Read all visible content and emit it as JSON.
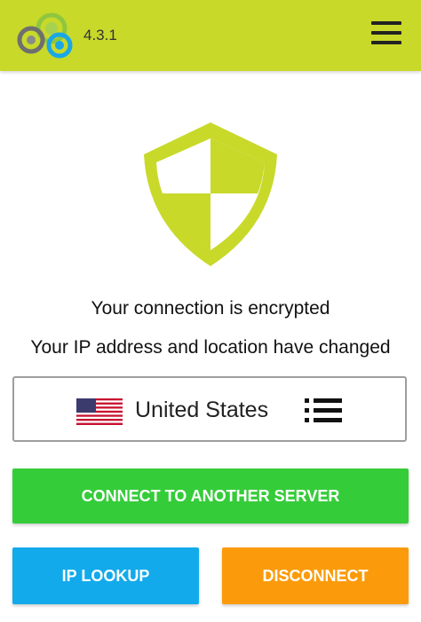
{
  "header": {
    "version": "4.3.1",
    "logo_icon": "app-logo-icon",
    "menu_icon": "hamburger-menu-icon",
    "background_color": "#c8d92a"
  },
  "status": {
    "shield_icon": "shield-icon",
    "shield_color": "#c8d92a",
    "line1": "Your connection is encrypted",
    "line2": "Your IP address and location have changed"
  },
  "server": {
    "flag_icon": "us-flag-icon",
    "country": "United States",
    "list_icon": "server-list-icon"
  },
  "buttons": {
    "connect_label": "CONNECT TO ANOTHER SERVER",
    "connect_color": "#35cc3a",
    "ip_lookup_label": "IP LOOKUP",
    "ip_lookup_color": "#12aaeb",
    "disconnect_label": "DISCONNECT",
    "disconnect_color": "#fb9b0b"
  }
}
